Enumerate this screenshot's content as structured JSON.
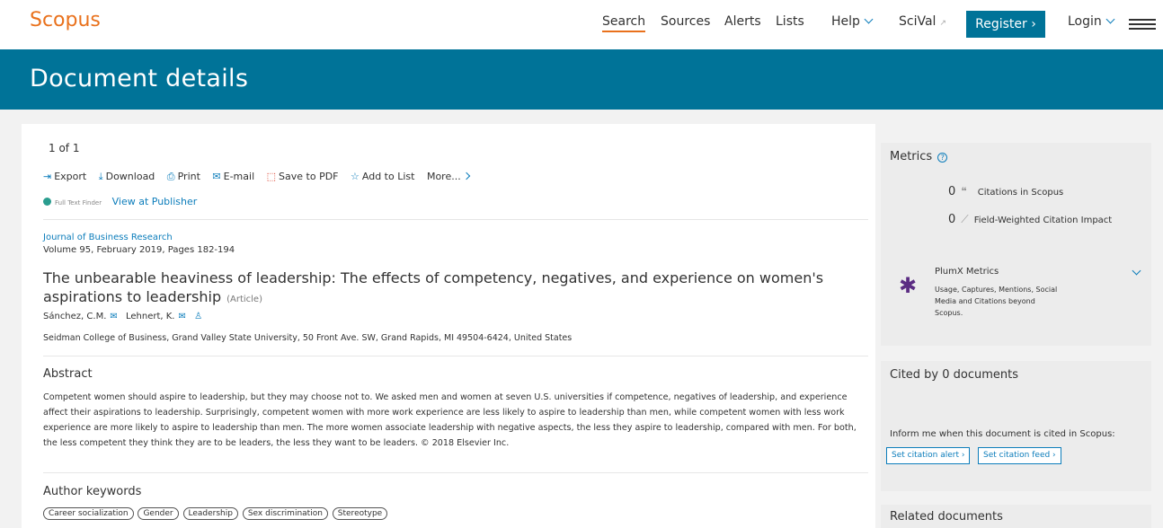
{
  "nav": {
    "logo": "Scopus",
    "search": "Search",
    "sources": "Sources",
    "alerts": "Alerts",
    "lists": "Lists",
    "help": "Help",
    "scival": "SciVal",
    "scival_ext": "↗",
    "register": "Register",
    "register_arrow": "›",
    "login": "Login"
  },
  "banner": {
    "title": "Document details"
  },
  "main": {
    "pager": "1 of 1",
    "toolbar": {
      "export": "Export",
      "download": "Download",
      "print": "Print",
      "email": "E-mail",
      "save_pdf": "Save to PDF",
      "add_list": "Add to List",
      "more": "More..."
    },
    "full_text_finder": "Full Text Finder",
    "view_publisher": "View at Publisher",
    "journal": "Journal of Business Research",
    "volume": "Volume 95, February 2019, Pages 182-194",
    "title": "The unbearable heaviness of leadership: The effects of competency, negatives, and experience on women's aspirations to leadership",
    "doc_type": "(Article)",
    "authors": [
      "Sánchez, C.M.",
      "Lehnert, K."
    ],
    "affiliation": "Seidman College of Business, Grand Valley State University, 50 Front Ave. SW, Grand Rapids, MI 49504-6424, United States",
    "abstract_heading": "Abstract",
    "abstract": "Competent women should aspire to leadership, but they may choose not to. We asked men and women at seven U.S. universities if competence, negatives of leadership, and experience affect their aspirations to leadership. Surprisingly, competent women with more work experience are less likely to aspire to leadership than men, while competent women with less work experience are more likely to aspire to leadership than men. The more women associate leadership with negative aspects, the less they aspire to leadership, compared with men. For both, the less competent they think they are to be leaders, the less they want to be leaders. © 2018 Elsevier Inc.",
    "keywords_heading": "Author keywords",
    "keywords": [
      "Career socialization",
      "Gender",
      "Leadership",
      "Sex discrimination",
      "Stereotype"
    ]
  },
  "metrics": {
    "heading": "Metrics",
    "citations_count": "0",
    "citations_label": "Citations in Scopus",
    "fwci_count": "0",
    "fwci_label": "Field-Weighted Citation Impact",
    "plumx_title": "PlumX Metrics",
    "plumx_desc": "Usage, Captures, Mentions, Social Media and Citations beyond Scopus."
  },
  "cited": {
    "heading": "Cited by 0 documents",
    "inform": "Inform me when this document is cited in Scopus:",
    "alert_btn": "Set citation alert ›",
    "feed_btn": "Set citation feed ›"
  },
  "related": {
    "heading": "Related documents"
  },
  "colors": {
    "brand_orange": "#e9711c",
    "banner_teal": "#007398",
    "link_blue": "#0c7dbb"
  }
}
